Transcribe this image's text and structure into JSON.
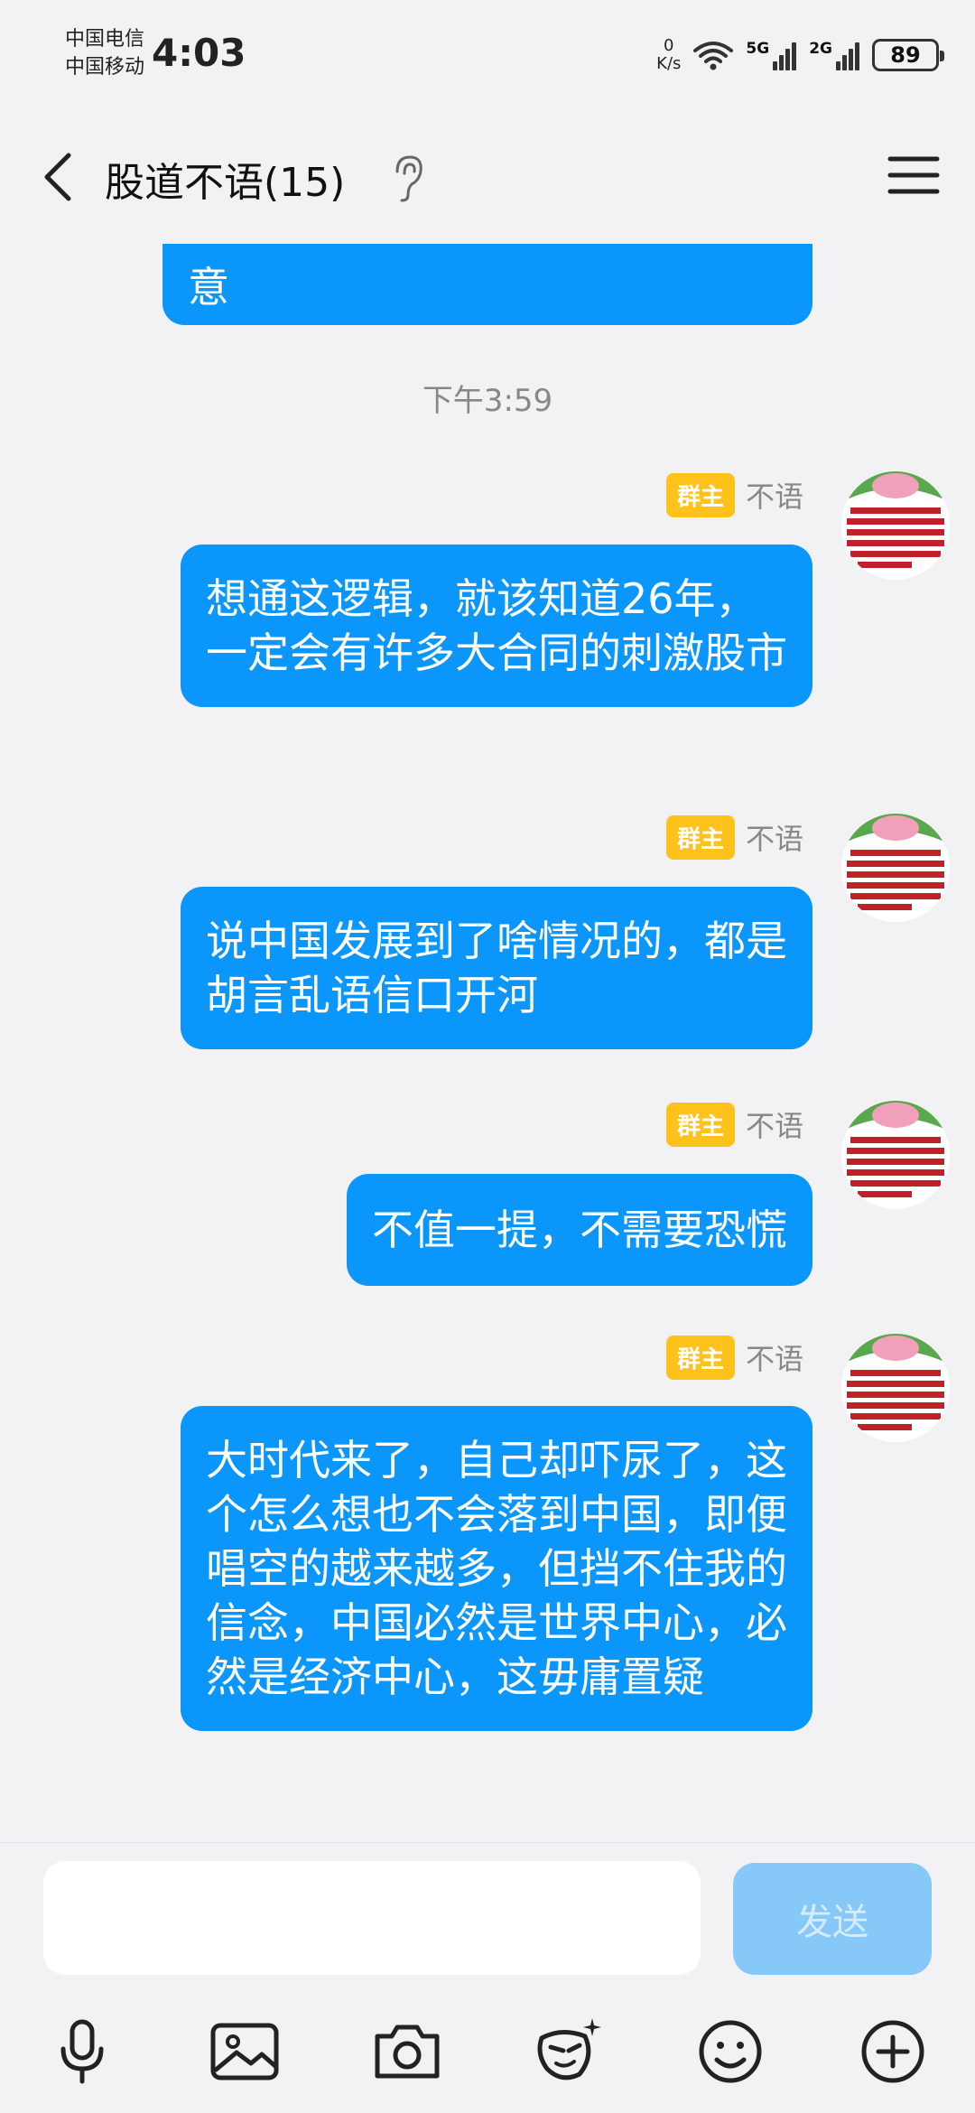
{
  "status_bar": {
    "carrier_1": "中国电信",
    "carrier_2": "中国移动",
    "time": "4:03",
    "net_speed_value": "0",
    "net_speed_unit": "K/s",
    "signal_1_label": "5G",
    "signal_2_label": "2G",
    "battery": "89"
  },
  "header": {
    "title": "股道不语(15)"
  },
  "messages": {
    "partial_text": "意",
    "timestamp": "下午3:59",
    "items": [
      {
        "badge": "群主",
        "sender": "不语",
        "text": "想通这逻辑，就该知道26年，一定会有许多大合同的刺激股市"
      },
      {
        "badge": "群主",
        "sender": "不语",
        "text": "说中国发展到了啥情况的，都是胡言乱语信口开河"
      },
      {
        "badge": "群主",
        "sender": "不语",
        "text": "不值一提，不需要恐慌"
      },
      {
        "badge": "群主",
        "sender": "不语",
        "text": "大时代来了，自己却吓尿了，这个怎么想也不会落到中国，即便唱空的越来越多，但挡不住我的信念，中国必然是世界中心，必然是经济中心，这毋庸置疑"
      }
    ]
  },
  "input": {
    "value": "",
    "placeholder": "",
    "send_label": "发送"
  },
  "toolbar_icons": [
    "microphone-icon",
    "image-icon",
    "camera-icon",
    "sticker-icon",
    "emoji-icon",
    "plus-icon"
  ],
  "colors": {
    "bubble": "#0a96fa",
    "badge": "#ffc21a",
    "send_disabled": "#86c8f8",
    "background": "#f2f2f5"
  }
}
